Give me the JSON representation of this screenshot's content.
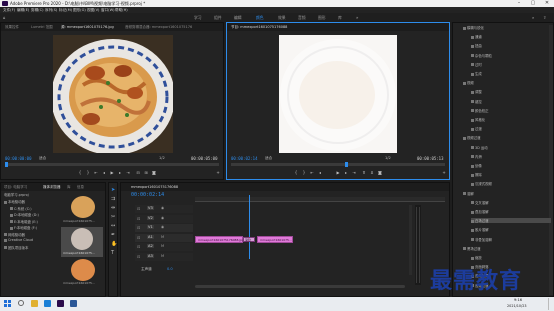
{
  "window": {
    "title": "Adobe Premiere Pro 2020 - D:\\电脑\\书\\BIM\\视频\\电脑学习-视频.prproj *",
    "minimize_glyph": "–",
    "maximize_glyph": "▢",
    "close_glyph": "✕"
  },
  "menu": [
    "文件(F)",
    "编辑(E)",
    "剪辑(C)",
    "序列(S)",
    "标记(M)",
    "图形(G)",
    "视图(V)",
    "窗口(W)",
    "帮助(H)"
  ],
  "workspaces": {
    "items": [
      "学习",
      "组件",
      "编辑",
      "颜色",
      "效果",
      "音频",
      "图形",
      "库"
    ],
    "active_index": 3
  },
  "source_monitor": {
    "tabs": [
      "效果控件",
      "Lumetri 范围",
      "源: mmexport1601075176.jpg",
      "音频剪辑混合器: mmexport1601075176"
    ],
    "active_tab": 2,
    "timecode_in": "00:00:00:00",
    "fit": "适合",
    "fraction": "1/2",
    "timecode_out": "00:00:05:00"
  },
  "program_monitor": {
    "tabs": [
      "节目: mmexport1601075176088"
    ],
    "timecode_in": "00:00:02:14",
    "fit": "适合",
    "fraction": "1/2",
    "timecode_out": "00:00:05:13"
  },
  "project_panel": {
    "tabs": [
      "项目: 电脑学习",
      "媒体浏览器",
      "库",
      "信息"
    ],
    "active_tab": 1,
    "path": "电脑学习.prproj",
    "tree": [
      "本地驱动器",
      "C:系统 (C:)",
      "D:本地磁盘 (D:)",
      "E:本地磁盘 (E:)",
      "F:本地磁盘 (F:)",
      "网络驱动器",
      "Creative Cloud",
      "团队项目版本"
    ],
    "thumbnails": [
      {
        "label": "mmexport1601075...",
        "selected": false
      },
      {
        "label": "mmexport1601075...",
        "selected": true
      },
      {
        "label": "mmexport1601075...",
        "selected": false
      }
    ]
  },
  "timeline": {
    "tab": "mmexport1601075176088",
    "timecode": "00:00:02:14",
    "tracks": [
      "V3",
      "V2",
      "V1",
      "A1",
      "A2",
      "A3"
    ],
    "master": "主声道",
    "master_value": "0.0",
    "clips": [
      {
        "label": "mmexport1601075176088.jpg",
        "color": "#e07ad9"
      },
      {
        "label": "渐隐",
        "color": "#d6a0d6"
      },
      {
        "label": "mmexport1601075...",
        "color": "#e07ad9"
      }
    ]
  },
  "effects_panel": {
    "items": [
      "模糊与锐化",
      "通道",
      "扭曲",
      "杂色与颗粒",
      "过时",
      "生成",
      "视频",
      "调整",
      "键控",
      "颜色校正",
      "风格化",
      "过渡",
      "视频过渡",
      "3D 运动",
      "内滑",
      "划像",
      "擦除",
      "沉浸式视频",
      "溶解",
      "交叉溶解",
      "叠加溶解",
      "白场过渡",
      "胶片溶解",
      "非叠加溶解",
      "黑场过渡",
      "缩放",
      "页面剥落",
      "音频效果",
      "音频过渡"
    ],
    "selected_index": 21
  },
  "taskbar": {
    "time": "9:16",
    "date": "2021/10/23"
  },
  "watermark": "最需教育",
  "colors": {
    "accent": "#2d8ceb",
    "clip": "#e07ad9"
  }
}
